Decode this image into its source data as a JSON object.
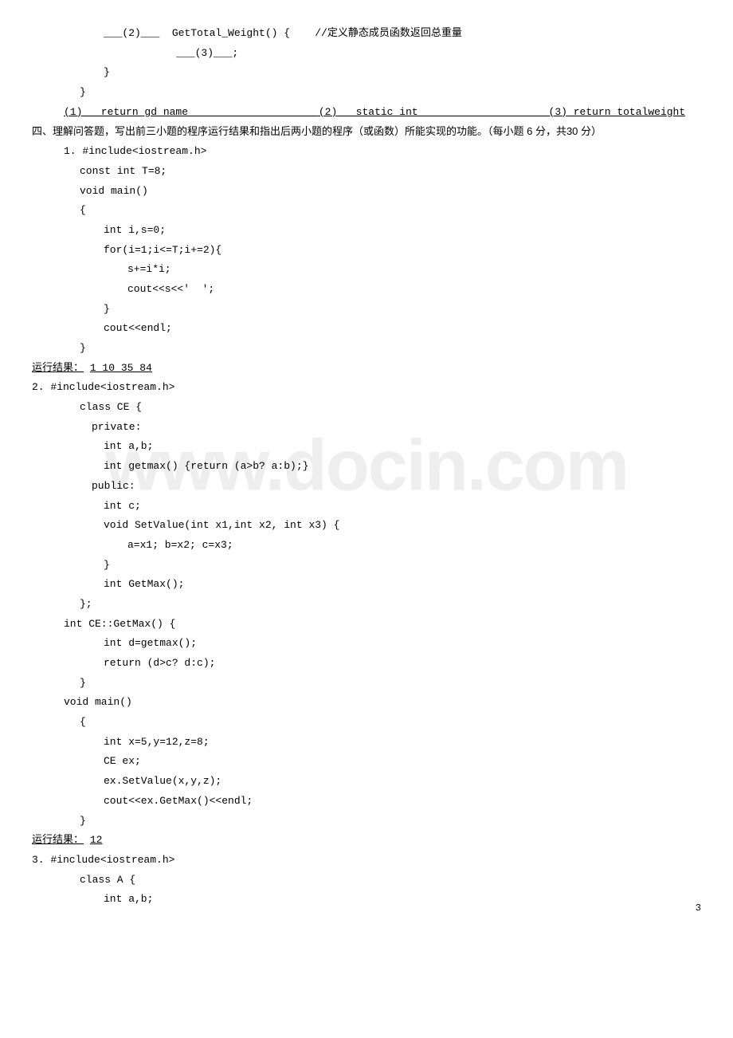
{
  "watermark": "www.docin.com",
  "page_number": "3",
  "top_code": {
    "l1": "___(2)___  GetTotal_Weight() {    //定义静态成员函数返回总重量",
    "l2": "    ___(3)___;",
    "l3": "}",
    "l4": "}"
  },
  "answer1": {
    "a1_label": "(1)",
    "a1": "   return gd_name                     ",
    "a2_label": "(2)",
    "a2": "   static int                     ",
    "a3_label": "(3)",
    "a3": " return totalweight"
  },
  "q4_title": "四、理解问答题，写出前三小题的程序运行结果和指出后两小题的程序（或函数）所能实现的功能。（每小题 6 分，共30 分）",
  "p1": {
    "l0": "1. #include<iostream.h>",
    "l1": "const int T=8;",
    "l2": "void main()",
    "l3": "{",
    "l4": "int i,s=0;",
    "l5": "for(i=1;i<=T;i+=2){",
    "l6": "s+=i*i;",
    "l7": "cout<<s<<'  ';",
    "l8": "}",
    "l9": "cout<<endl;",
    "l10": "}",
    "result_label": "   运行结果：",
    "result": "   1 10 35 84 "
  },
  "p2": {
    "l0": "2. #include<iostream.h>",
    "l1": "class CE {",
    "l2": "private:",
    "l3": "int a,b;",
    "l4": "int getmax() {return (a>b? a:b);}",
    "l5": "public:",
    "l6": "int c;",
    "l7": "void SetValue(int x1,int x2, int x3) {",
    "l8": "a=x1; b=x2; c=x3;",
    "l9": "}",
    "l10": "int GetMax();",
    "l11": "};",
    "l12": "int CE::GetMax() {",
    "l13": "int d=getmax();",
    "l14": "return (d>c? d:c);",
    "l15": "}",
    "l16": "void main()",
    "l17": "{",
    "l18": "int x=5,y=12,z=8;",
    "l19": "CE ex;",
    "l20": "ex.SetValue(x,y,z);",
    "l21": "cout<<ex.GetMax()<<endl;",
    "l22": "}",
    "result_label": "运行结果：",
    "result": "  12"
  },
  "p3": {
    "l0": "3. #include<iostream.h>",
    "l1": "class A {",
    "l2": "int a,b;"
  }
}
